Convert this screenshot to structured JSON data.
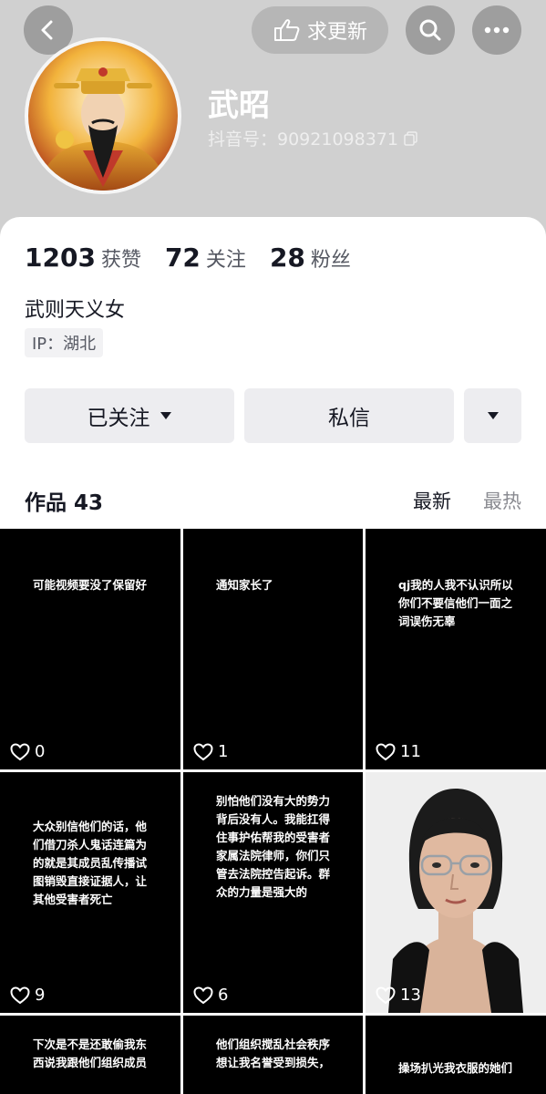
{
  "header": {
    "update_label": "求更新",
    "username": "武昭",
    "douyin_id": "抖音号：90921098371"
  },
  "stats": [
    {
      "value": "1203",
      "label": "获赞"
    },
    {
      "value": "72",
      "label": "关注"
    },
    {
      "value": "28",
      "label": "粉丝"
    }
  ],
  "bio": "武则天义女",
  "ip": "IP：湖北",
  "buttons": {
    "follow": "已关注",
    "message": "私信"
  },
  "works": {
    "title": "作品 43",
    "sort_new": "最新",
    "sort_hot": "最热"
  },
  "videos": [
    {
      "caption": "可能视频要没了保留好",
      "likes": "0"
    },
    {
      "caption": "通知家长了",
      "likes": "1"
    },
    {
      "caption": "qj我的人我不认识所以你们不要信他们一面之词误伤无辜",
      "likes": "11"
    },
    {
      "caption": "大众别信他们的话，他们借刀杀人鬼话连篇为的就是其成员乱传播试图销毁直接证据人，让其他受害者死亡",
      "likes": "9"
    },
    {
      "caption": "别怕他们没有大的势力背后没有人。我能扛得住事护佑帮我的受害者家属法院律师，你们只管去法院控告起诉。群众的力量是强大的",
      "likes": "6"
    },
    {
      "caption": "",
      "likes": "13"
    },
    {
      "caption": "下次是不是还敢偷我东西说我跟他们组织成员",
      "likes": ""
    },
    {
      "caption": "他们组织搅乱社会秩序想让我名誉受到损失，",
      "likes": ""
    },
    {
      "caption": "操场扒光我衣服的她们",
      "likes": ""
    }
  ],
  "icons": {
    "back": "chevron-left-icon",
    "hand": "pointing-hand-icon",
    "search": "search-icon",
    "more": "more-dots-icon",
    "copy": "copy-icon",
    "caret": "caret-down-icon",
    "heart": "heart-outline-icon"
  }
}
